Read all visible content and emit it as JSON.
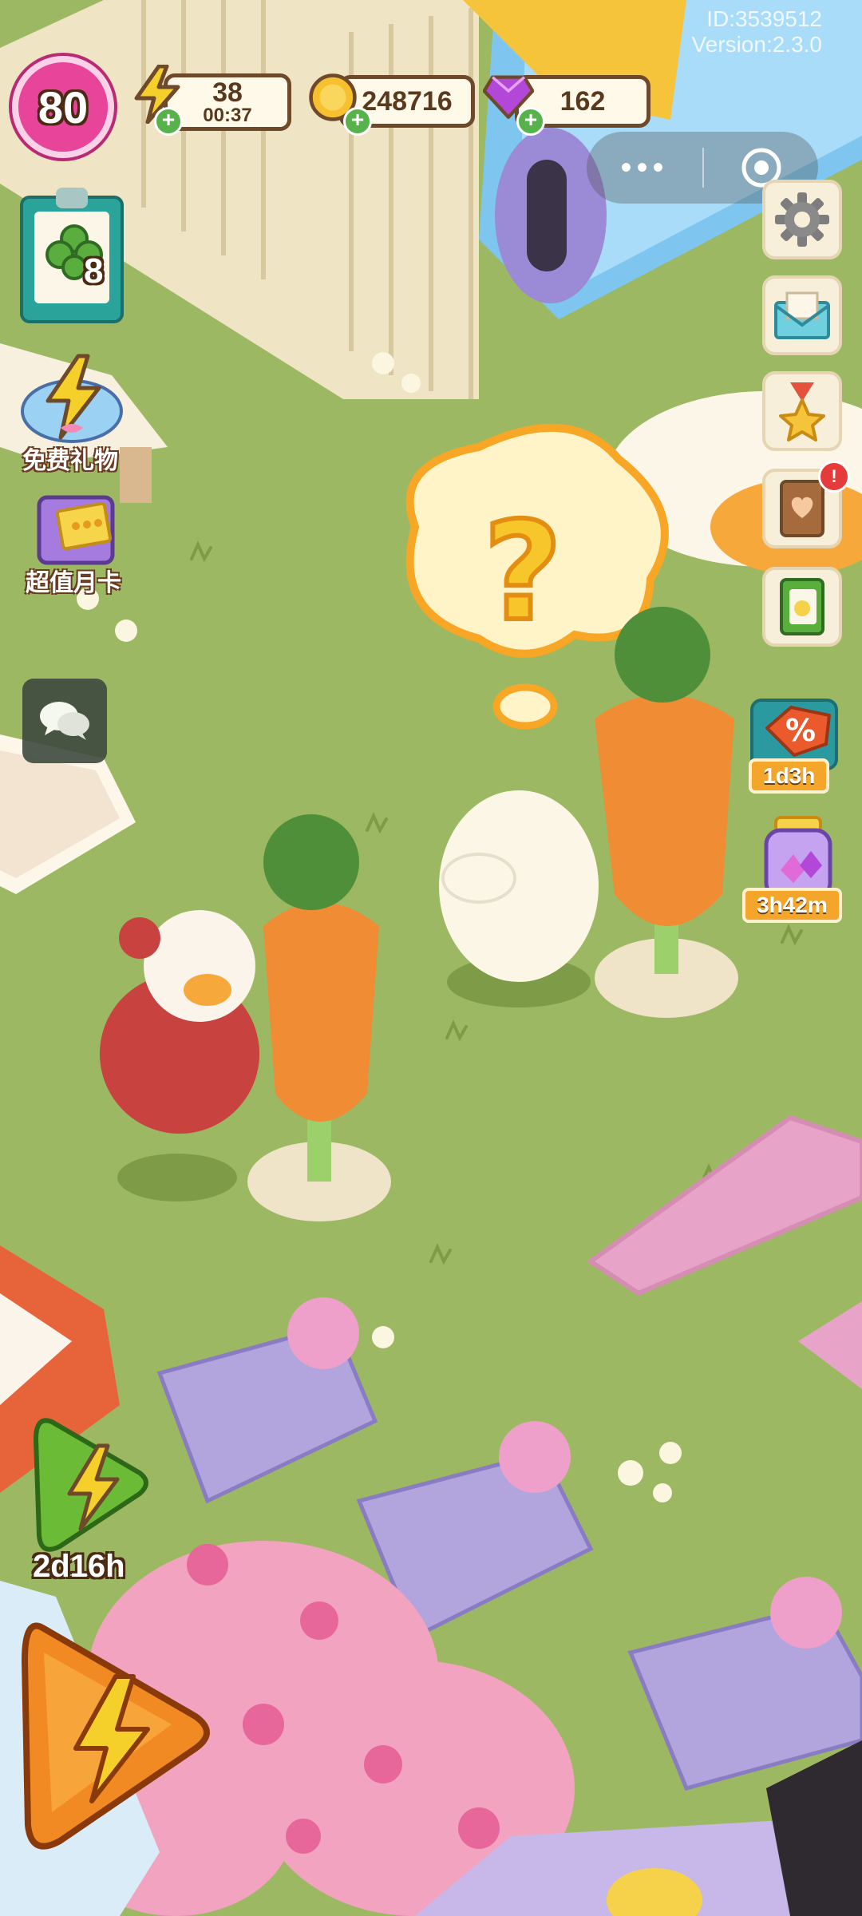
{
  "top_right_overlay": {
    "id_text": "ID:3539512",
    "version_text": "Version:2.3.0"
  },
  "player": {
    "level": "80"
  },
  "resources": {
    "energy": {
      "value": "38",
      "timer": "00:37",
      "icon": "lightning-icon"
    },
    "coins": {
      "value": "248716",
      "icon": "coin-icon"
    },
    "gems": {
      "value": "162",
      "icon": "gem-icon"
    }
  },
  "task_board": {
    "count": "8",
    "icon": "clipboard-clover-icon"
  },
  "left_menu": {
    "free_gift_label": "免费礼物",
    "monthly_card_label": "超值月卡"
  },
  "right_menu": {
    "sale_timer": "1d3h",
    "jar_timer": "3h42m"
  },
  "bottom_left": {
    "energy_event_timer": "2d16h"
  },
  "colors": {
    "grass": "#9cb862",
    "pill_border": "#6e4a2a",
    "level_badge": "#e8449a",
    "timer_tag": "#f4a62a",
    "plus_green": "#58b24c"
  }
}
